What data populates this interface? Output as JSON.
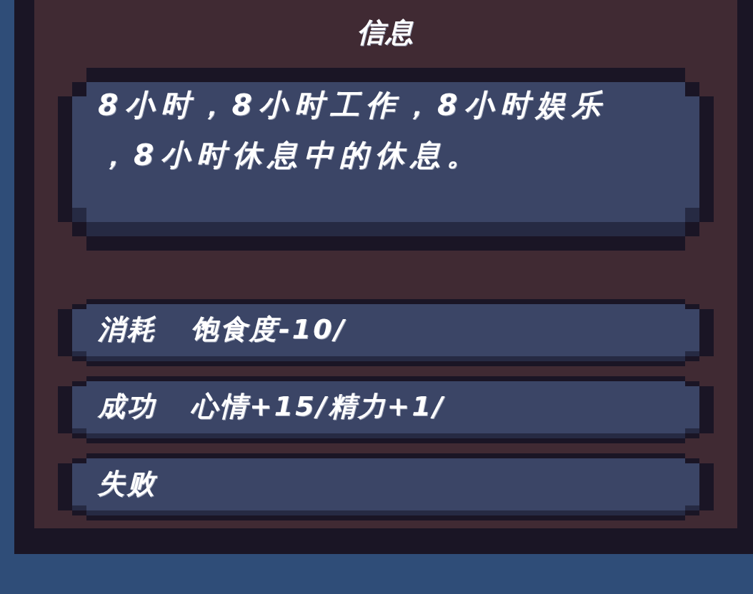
{
  "panel": {
    "title": "信息",
    "description": "8小时，8小时工作，8小时娱乐，8小时休息中的休息。"
  },
  "outcomes": [
    {
      "label": "消耗",
      "value": "饱食度-10/"
    },
    {
      "label": "成功",
      "value": "心情+15/精力+1/"
    },
    {
      "label": "失败"
    }
  ]
}
